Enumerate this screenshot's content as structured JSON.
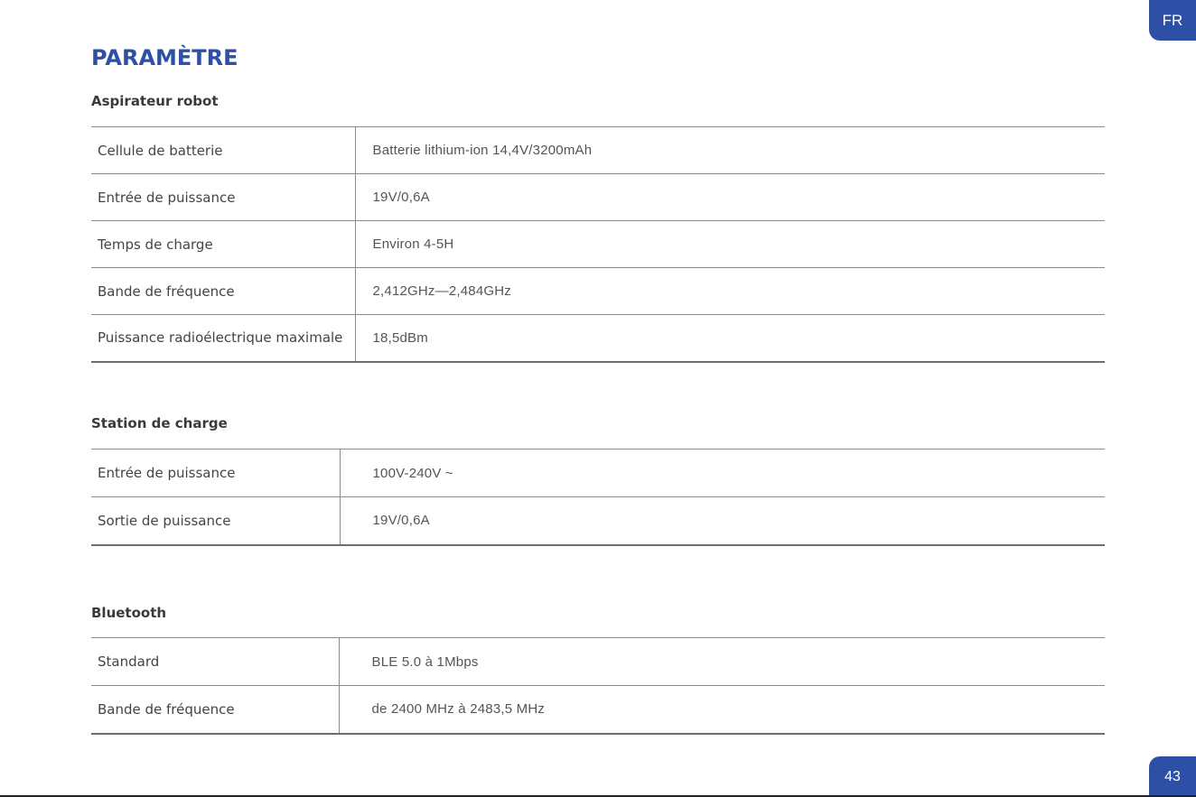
{
  "lang": "FR",
  "page_number": "43",
  "title": "PARAMÈTRE",
  "sections": [
    {
      "title": "Aspirateur robot",
      "rows": [
        {
          "label": "Cellule de batterie",
          "value": "Batterie lithium-ion 14,4V/3200mAh"
        },
        {
          "label": "Entrée de puissance",
          "value": "19V/0,6A"
        },
        {
          "label": "Temps de charge",
          "value": "Environ 4-5H"
        },
        {
          "label": "Bande de fréquence",
          "value": "2,412GHz—2,484GHz"
        },
        {
          "label": "Puissance radioélectrique maximale",
          "value": "18,5dBm"
        }
      ]
    },
    {
      "title": "Station de charge",
      "rows": [
        {
          "label": "Entrée de puissance",
          "value": "100V-240V ~"
        },
        {
          "label": "Sortie de puissance",
          "value": "19V/0,6A"
        }
      ]
    },
    {
      "title": "Bluetooth",
      "rows": [
        {
          "label": "Standard",
          "value": "BLE 5.0 à 1Mbps"
        },
        {
          "label": "Bande de fréquence",
          "value": "de 2400 MHz à 2483,5 MHz"
        }
      ]
    }
  ]
}
